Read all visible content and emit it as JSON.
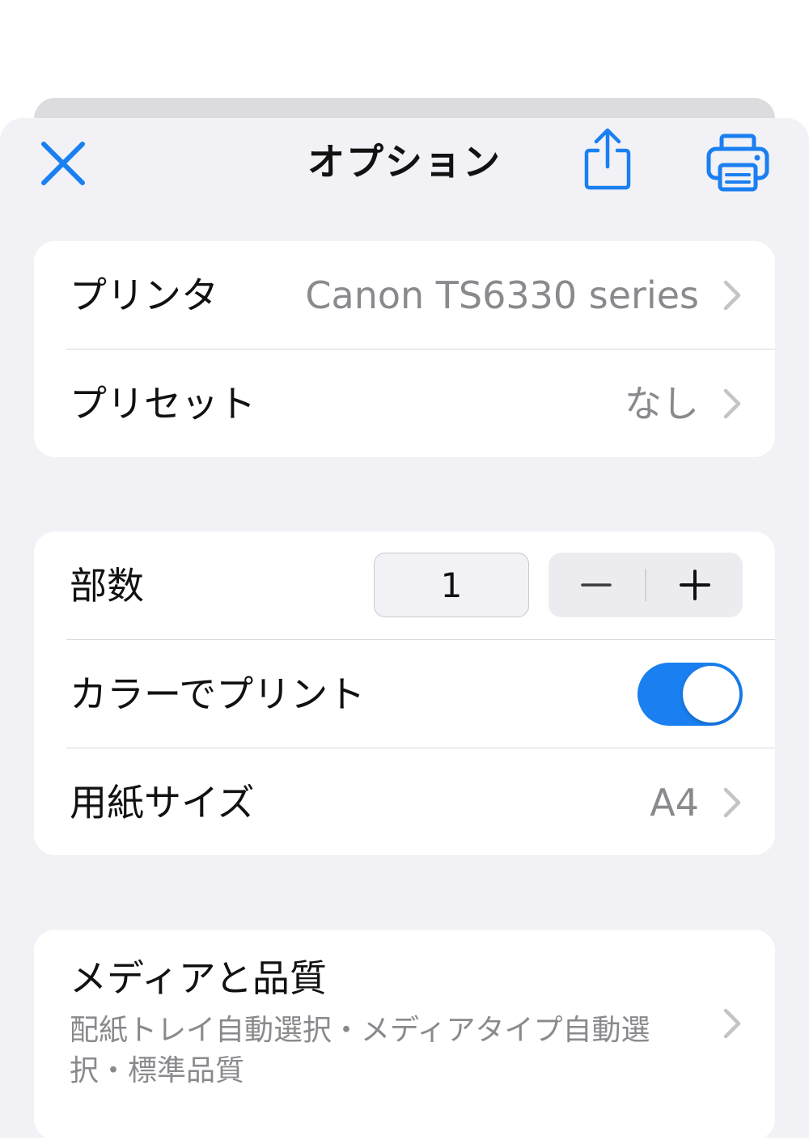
{
  "nav": {
    "title": "オプション"
  },
  "icons": {
    "close": "close-icon",
    "share": "share-icon",
    "print": "printer-icon",
    "chevron": "chevron-right-icon"
  },
  "colors": {
    "accent": "#1a7ff0",
    "secondary_text": "#8a8a8e",
    "background": "#f1f1f6"
  },
  "printer_group": {
    "printer_label": "プリンタ",
    "printer_value": "Canon TS6330 series",
    "preset_label": "プリセット",
    "preset_value": "なし"
  },
  "settings_group": {
    "copies_label": "部数",
    "copies_value": "1",
    "stepper_minus": "−",
    "stepper_plus": "+",
    "color_label": "カラーでプリント",
    "color_enabled": true,
    "paper_label": "用紙サイズ",
    "paper_value": "A4"
  },
  "media_group": {
    "title": "メディアと品質",
    "subtitle": "配紙トレイ自動選択・メディアタイプ自動選択・標準品質"
  }
}
